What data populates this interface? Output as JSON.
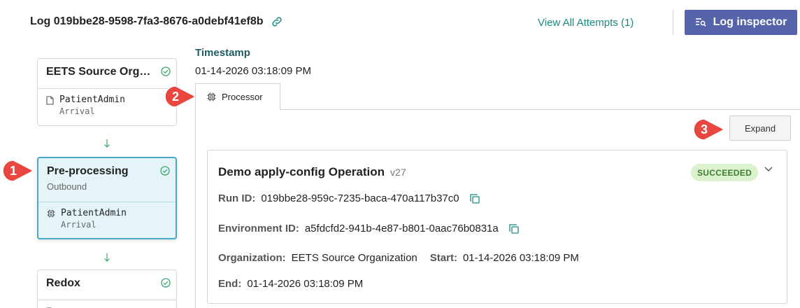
{
  "header": {
    "log_title": "Log 019bbe28-9598-7fa3-8676-a0debf41ef8b",
    "view_all_attempts": "View All Attempts (1)",
    "log_inspector": "Log inspector"
  },
  "flow": {
    "nodes": [
      {
        "title": "EETS Source Orga...",
        "subtitle": "",
        "item": "PatientAdmin",
        "item_sub": "Arrival"
      },
      {
        "title": "Pre-processing",
        "subtitle": "Outbound",
        "item": "PatientAdmin",
        "item_sub": "Arrival"
      },
      {
        "title": "Redox",
        "subtitle": "",
        "item": "",
        "item_sub": ""
      }
    ]
  },
  "timestamp": {
    "label": "Timestamp",
    "value": "01-14-2026 03:18:09 PM"
  },
  "tabs": {
    "processor": "Processor"
  },
  "panel": {
    "expand_label": "Expand"
  },
  "operation": {
    "title": "Demo apply-config Operation",
    "version": "v27",
    "status": "SUCCEEDED",
    "run_id_label": "Run ID:",
    "run_id": "019bbe28-959c-7235-baca-470a117b37c0",
    "env_id_label": "Environment ID:",
    "env_id": "a5fdcfd2-941b-4e87-b801-0aac76b0831a",
    "org_label": "Organization:",
    "org": "EETS Source Organization",
    "start_label": "Start:",
    "start": "01-14-2026 03:18:09 PM",
    "end_label": "End:",
    "end": "01-14-2026 03:18:09 PM"
  },
  "callouts": [
    "1",
    "2",
    "3"
  ],
  "colors": {
    "accent": "#1b8a7c",
    "button_primary": "#5563a8",
    "active_node_bg": "#e5f4f8",
    "active_node_border": "#4aa8c8",
    "success_bg": "#dcf2cf",
    "success_text": "#3e7d2f",
    "callout_red": "#e8463e"
  }
}
